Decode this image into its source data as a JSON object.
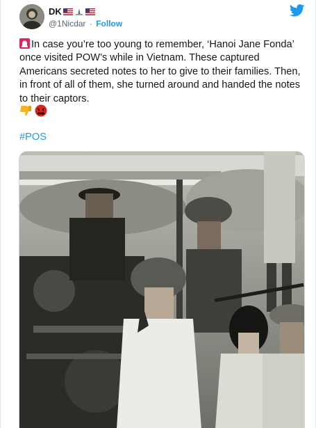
{
  "tweet": {
    "author_name": "DK",
    "handle": "@1Nicdar",
    "separator": "·",
    "follow_label": "Follow",
    "body_text": "In case you’re too young to remember, ‘Hanoi Jane Fonda’ once visited POW’s while in Vietnam. These captured Americans secreted notes to her to give to their families. Then, in front of all of them, she turned around and handed the notes to their captors.",
    "hashtag": "#POS"
  },
  "icons": {
    "author_flags": [
      "us-flag-icon",
      "tower-icon",
      "us-flag-icon"
    ],
    "leading_emoji": "siren-icon",
    "trailing_emojis": [
      "thumbs-down-icon",
      "angry-face-icon"
    ],
    "platform": "twitter-bird-icon"
  },
  "media": {
    "type": "black-and-white-photo"
  },
  "colors": {
    "link": "#1d9bf0",
    "text": "#14171a",
    "muted": "#536471"
  }
}
